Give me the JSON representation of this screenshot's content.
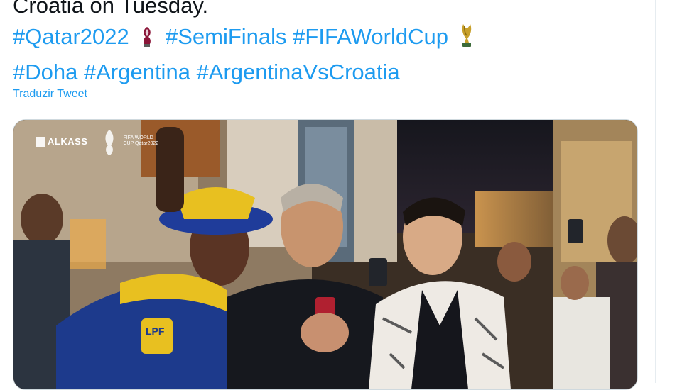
{
  "tweet": {
    "line1": "Croatia on Tuesday.",
    "hashtags_line2": [
      "#Qatar2022",
      "#SemiFinals",
      "#FIFAWorldCup"
    ],
    "hashtags_line3": [
      "#Doha",
      "#Argentina",
      "#ArgentinaVsCroatia"
    ],
    "translate_link": "Traduzir Tweet"
  },
  "media": {
    "broadcaster": "ALKASS",
    "event_badge": "FIFA WORLD CUP Qatar2022",
    "badge_text": "LPF"
  },
  "icons": {
    "world_cup_logo": "world-cup-emblem-icon",
    "trophy": "trophy-icon"
  },
  "colors": {
    "link": "#1d9bf0",
    "text": "#0f1419"
  }
}
